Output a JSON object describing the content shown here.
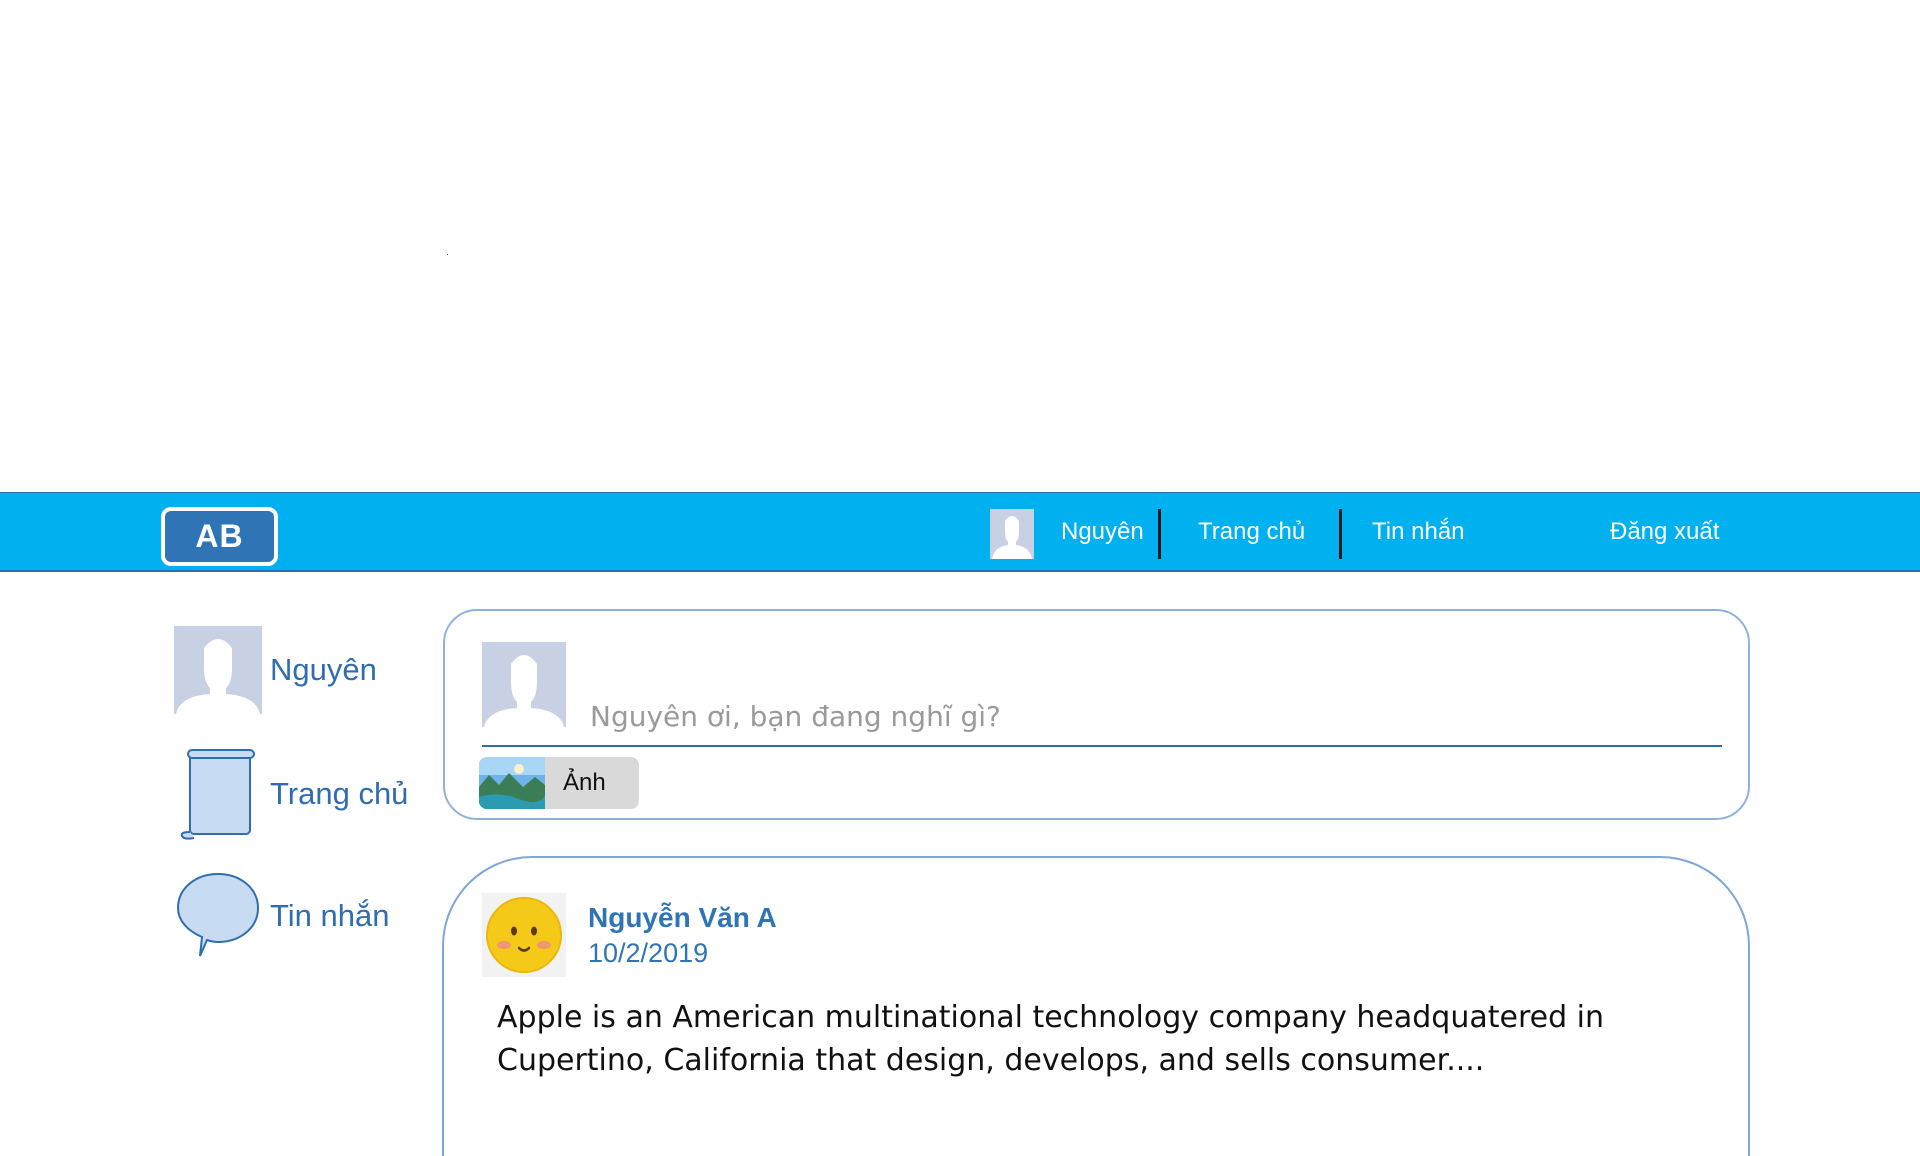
{
  "header": {
    "logo": "AB",
    "user_name": "Nguyên",
    "nav": [
      "Trang chủ",
      "Tin nhắn",
      "Đăng xuất"
    ]
  },
  "sidebar": {
    "items": [
      {
        "label": "Nguyên",
        "icon": "avatar-icon"
      },
      {
        "label": "Trang chủ",
        "icon": "scroll-icon"
      },
      {
        "label": "Tin nhắn",
        "icon": "speech-bubble-icon"
      }
    ]
  },
  "composer": {
    "placeholder": "Nguyên ơi, bạn đang nghĩ gì?",
    "photo_label": "Ảnh"
  },
  "post": {
    "author": "Nguyễn Văn A",
    "date": "10/2/2019",
    "text": "Apple is an American multinational technology company headquatered in Cupertino, California that design, develops, and sells consumer...."
  },
  "colors": {
    "nav_bg": "#00b0ef",
    "accent": "#2f6db0",
    "logo_bg": "#2f74b5",
    "card_border": "#8fb2dd"
  }
}
